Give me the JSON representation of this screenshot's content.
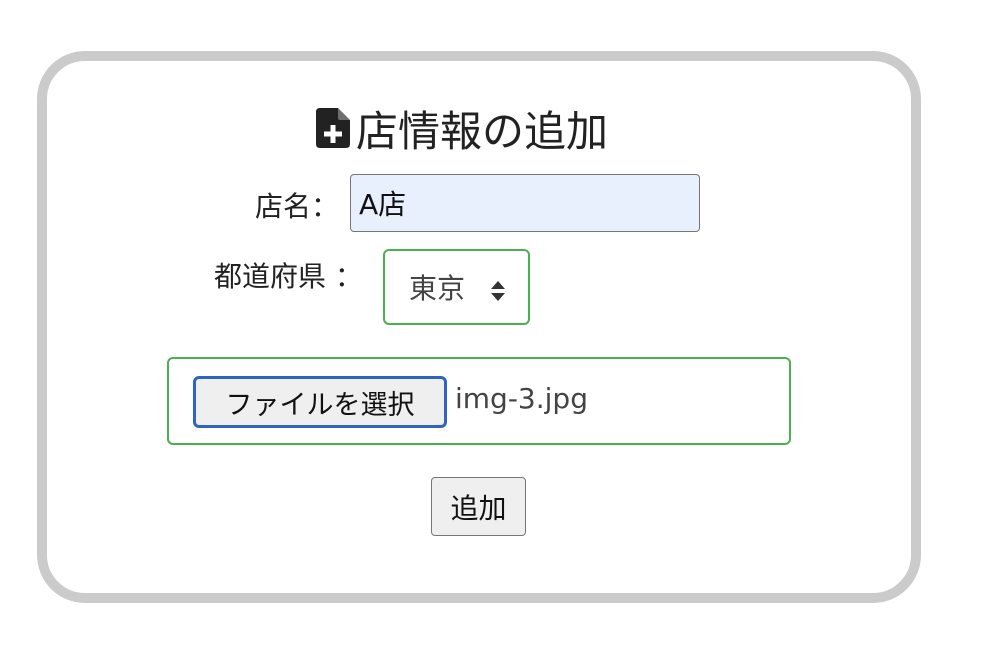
{
  "form": {
    "title": "店情報の追加",
    "title_icon": "file-plus-icon",
    "name_label": "店名：",
    "name_value": "A店",
    "prefecture_label": "都道府県 ：",
    "prefecture_selected": "東京",
    "file_button_label": "ファイルを選択",
    "file_name": "img-3.jpg",
    "submit_label": "追加"
  },
  "colors": {
    "card_border": "#cbcbcb",
    "focus_green": "#4caf50",
    "autofill_bg": "#e8f0fe",
    "focus_blue": "#2f64c0"
  }
}
